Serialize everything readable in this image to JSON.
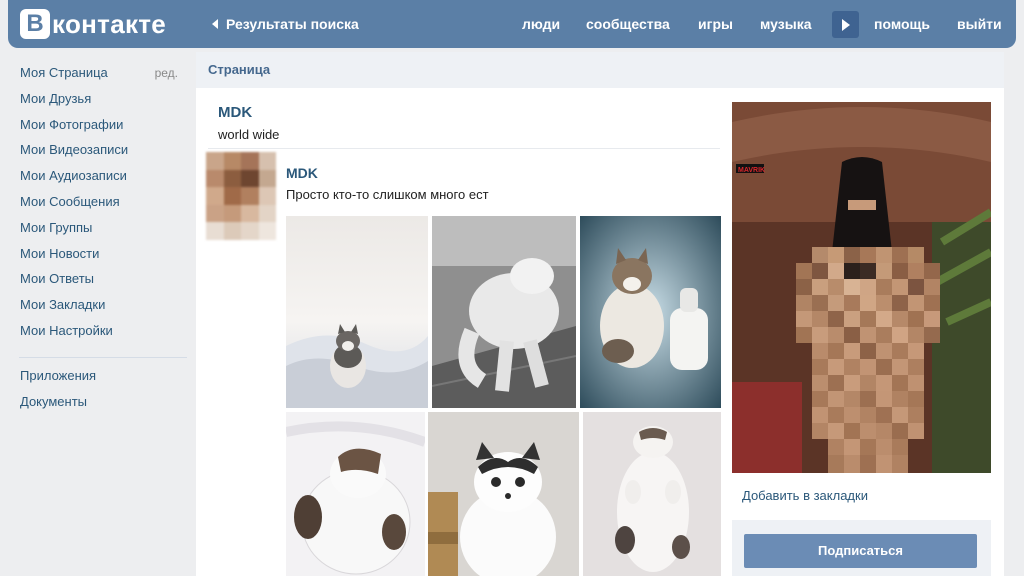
{
  "header": {
    "logo_letter": "В",
    "logo_text": "контакте",
    "back_label": "Результаты поиска",
    "nav": [
      "люди",
      "сообщества",
      "игры",
      "музыка",
      "помощь",
      "выйти"
    ]
  },
  "sidebar": {
    "items": [
      {
        "label": "Моя Страница",
        "edit": "ред."
      },
      {
        "label": "Мои Друзья"
      },
      {
        "label": "Мои Фотографии"
      },
      {
        "label": "Мои Видеозаписи"
      },
      {
        "label": "Мои Аудиозаписи"
      },
      {
        "label": "Мои Сообщения"
      },
      {
        "label": "Мои Группы"
      },
      {
        "label": "Мои Новости"
      },
      {
        "label": "Мои Ответы"
      },
      {
        "label": "Мои Закладки"
      },
      {
        "label": "Мои Настройки"
      }
    ],
    "extra": [
      "Приложения",
      "Документы"
    ]
  },
  "main": {
    "section_title": "Страница",
    "page_name": "MDK",
    "page_status": "world wide",
    "post": {
      "author": "MDK",
      "text": "Просто кто-то слишком много ест"
    },
    "ad": {
      "image_caption": "MAVRIK",
      "bookmark_label": "Добавить в закладки",
      "subscribe_label": "Подписаться"
    }
  },
  "colors": {
    "header": "#5b7fa6",
    "link": "#2b587a",
    "button": "#6b8cb5"
  }
}
